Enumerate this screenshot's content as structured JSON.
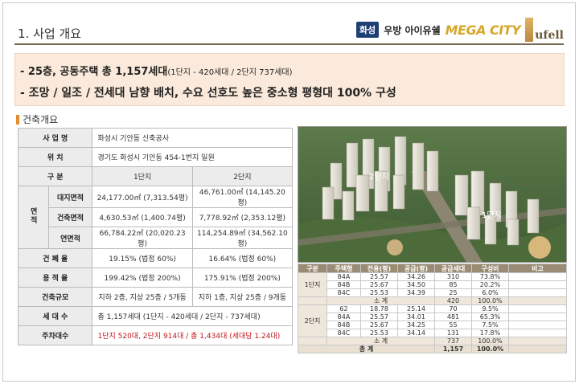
{
  "header": {
    "section_title": "1. 사업 개요",
    "brand_tag": "화성",
    "brand_name": "우방 아이유쉘",
    "brand_mega": "MEGA CITY",
    "brand_logo_text": "ufell"
  },
  "summary": {
    "line1_main": "- 25층, 공동주택 총 1,157세대",
    "line1_detail": "(1단지 - 420세대 / 2단지 737세대)",
    "line2": "- 조망 / 일조 / 전세대 남향 배치, 수요 선호도 높은 중소형 평형대 100% 구성"
  },
  "overview": {
    "heading": "건축개요",
    "business_name_label": "사 업 명",
    "business_name": "화성시 기안동 신축공사",
    "location_label": "위   치",
    "location": "경기도 화성시 기안동 454-1번지 일원",
    "division_label": "구   분",
    "col1": "1단지",
    "col2": "2단지",
    "area_label": "면적",
    "site_area_label": "대지면적",
    "site_area_1": "24,177.00㎡ (7,313.54평)",
    "site_area_2": "46,761.00㎡ (14,145.20평)",
    "building_area_label": "건축면적",
    "building_area_1": "4,630.53㎡ (1,400.74평)",
    "building_area_2": "7,778.92㎡ (2,353.12평)",
    "floor_area_label": "연면적",
    "floor_area_1": "66,784.22㎡ (20,020.23평)",
    "floor_area_2": "114,254.89㎡ (34,562.10평)",
    "coverage_label": "건 폐 율",
    "coverage_1": "19.15% (법정 60%)",
    "coverage_2": "16.64% (법정 60%)",
    "far_label": "용 적 율",
    "far_1": "199.42% (법정 200%)",
    "far_2": "175.91% (법정 200%)",
    "scale_label": "건축규모",
    "scale_1": "지하 2층, 지상 25층 / 5개동",
    "scale_2": "지하 1층, 지상 25층 / 9개동",
    "households_label": "세 대 수",
    "households": "총 1,157세대 (1단지 - 420세대 / 2단지 - 737세대)",
    "parking_label": "주차대수",
    "parking": "1단지 520대, 2단지 914대 / 총 1,434대  (세대당 1.24대)"
  },
  "render": {
    "label_complex2": "2단지",
    "label_complex1": "1단지"
  },
  "units": {
    "headers": [
      "구분",
      "주택형",
      "전용(평)",
      "공급(평)",
      "공급세대",
      "구성비",
      "비고"
    ],
    "complex1_label": "1단지",
    "complex1_rows": [
      [
        "84A",
        "25.57",
        "34.26",
        "310",
        "73.8%"
      ],
      [
        "84B",
        "25.67",
        "34.50",
        "85",
        "20.2%"
      ],
      [
        "84C",
        "25.53",
        "34.39",
        "25",
        "6.0%"
      ]
    ],
    "complex1_subtotal": [
      "소 계",
      "420",
      "100.0%"
    ],
    "complex2_label": "2단지",
    "complex2_rows": [
      [
        "62",
        "18.78",
        "25.14",
        "70",
        "9.5%"
      ],
      [
        "84A",
        "25.57",
        "34.01",
        "481",
        "65.3%"
      ],
      [
        "84B",
        "25.67",
        "34.25",
        "55",
        "7.5%"
      ],
      [
        "84C",
        "25.53",
        "34.14",
        "131",
        "17.8%"
      ]
    ],
    "complex2_subtotal": [
      "소 계",
      "737",
      "100.0%"
    ],
    "total": [
      "총 계",
      "1,157",
      "100.0%"
    ]
  }
}
